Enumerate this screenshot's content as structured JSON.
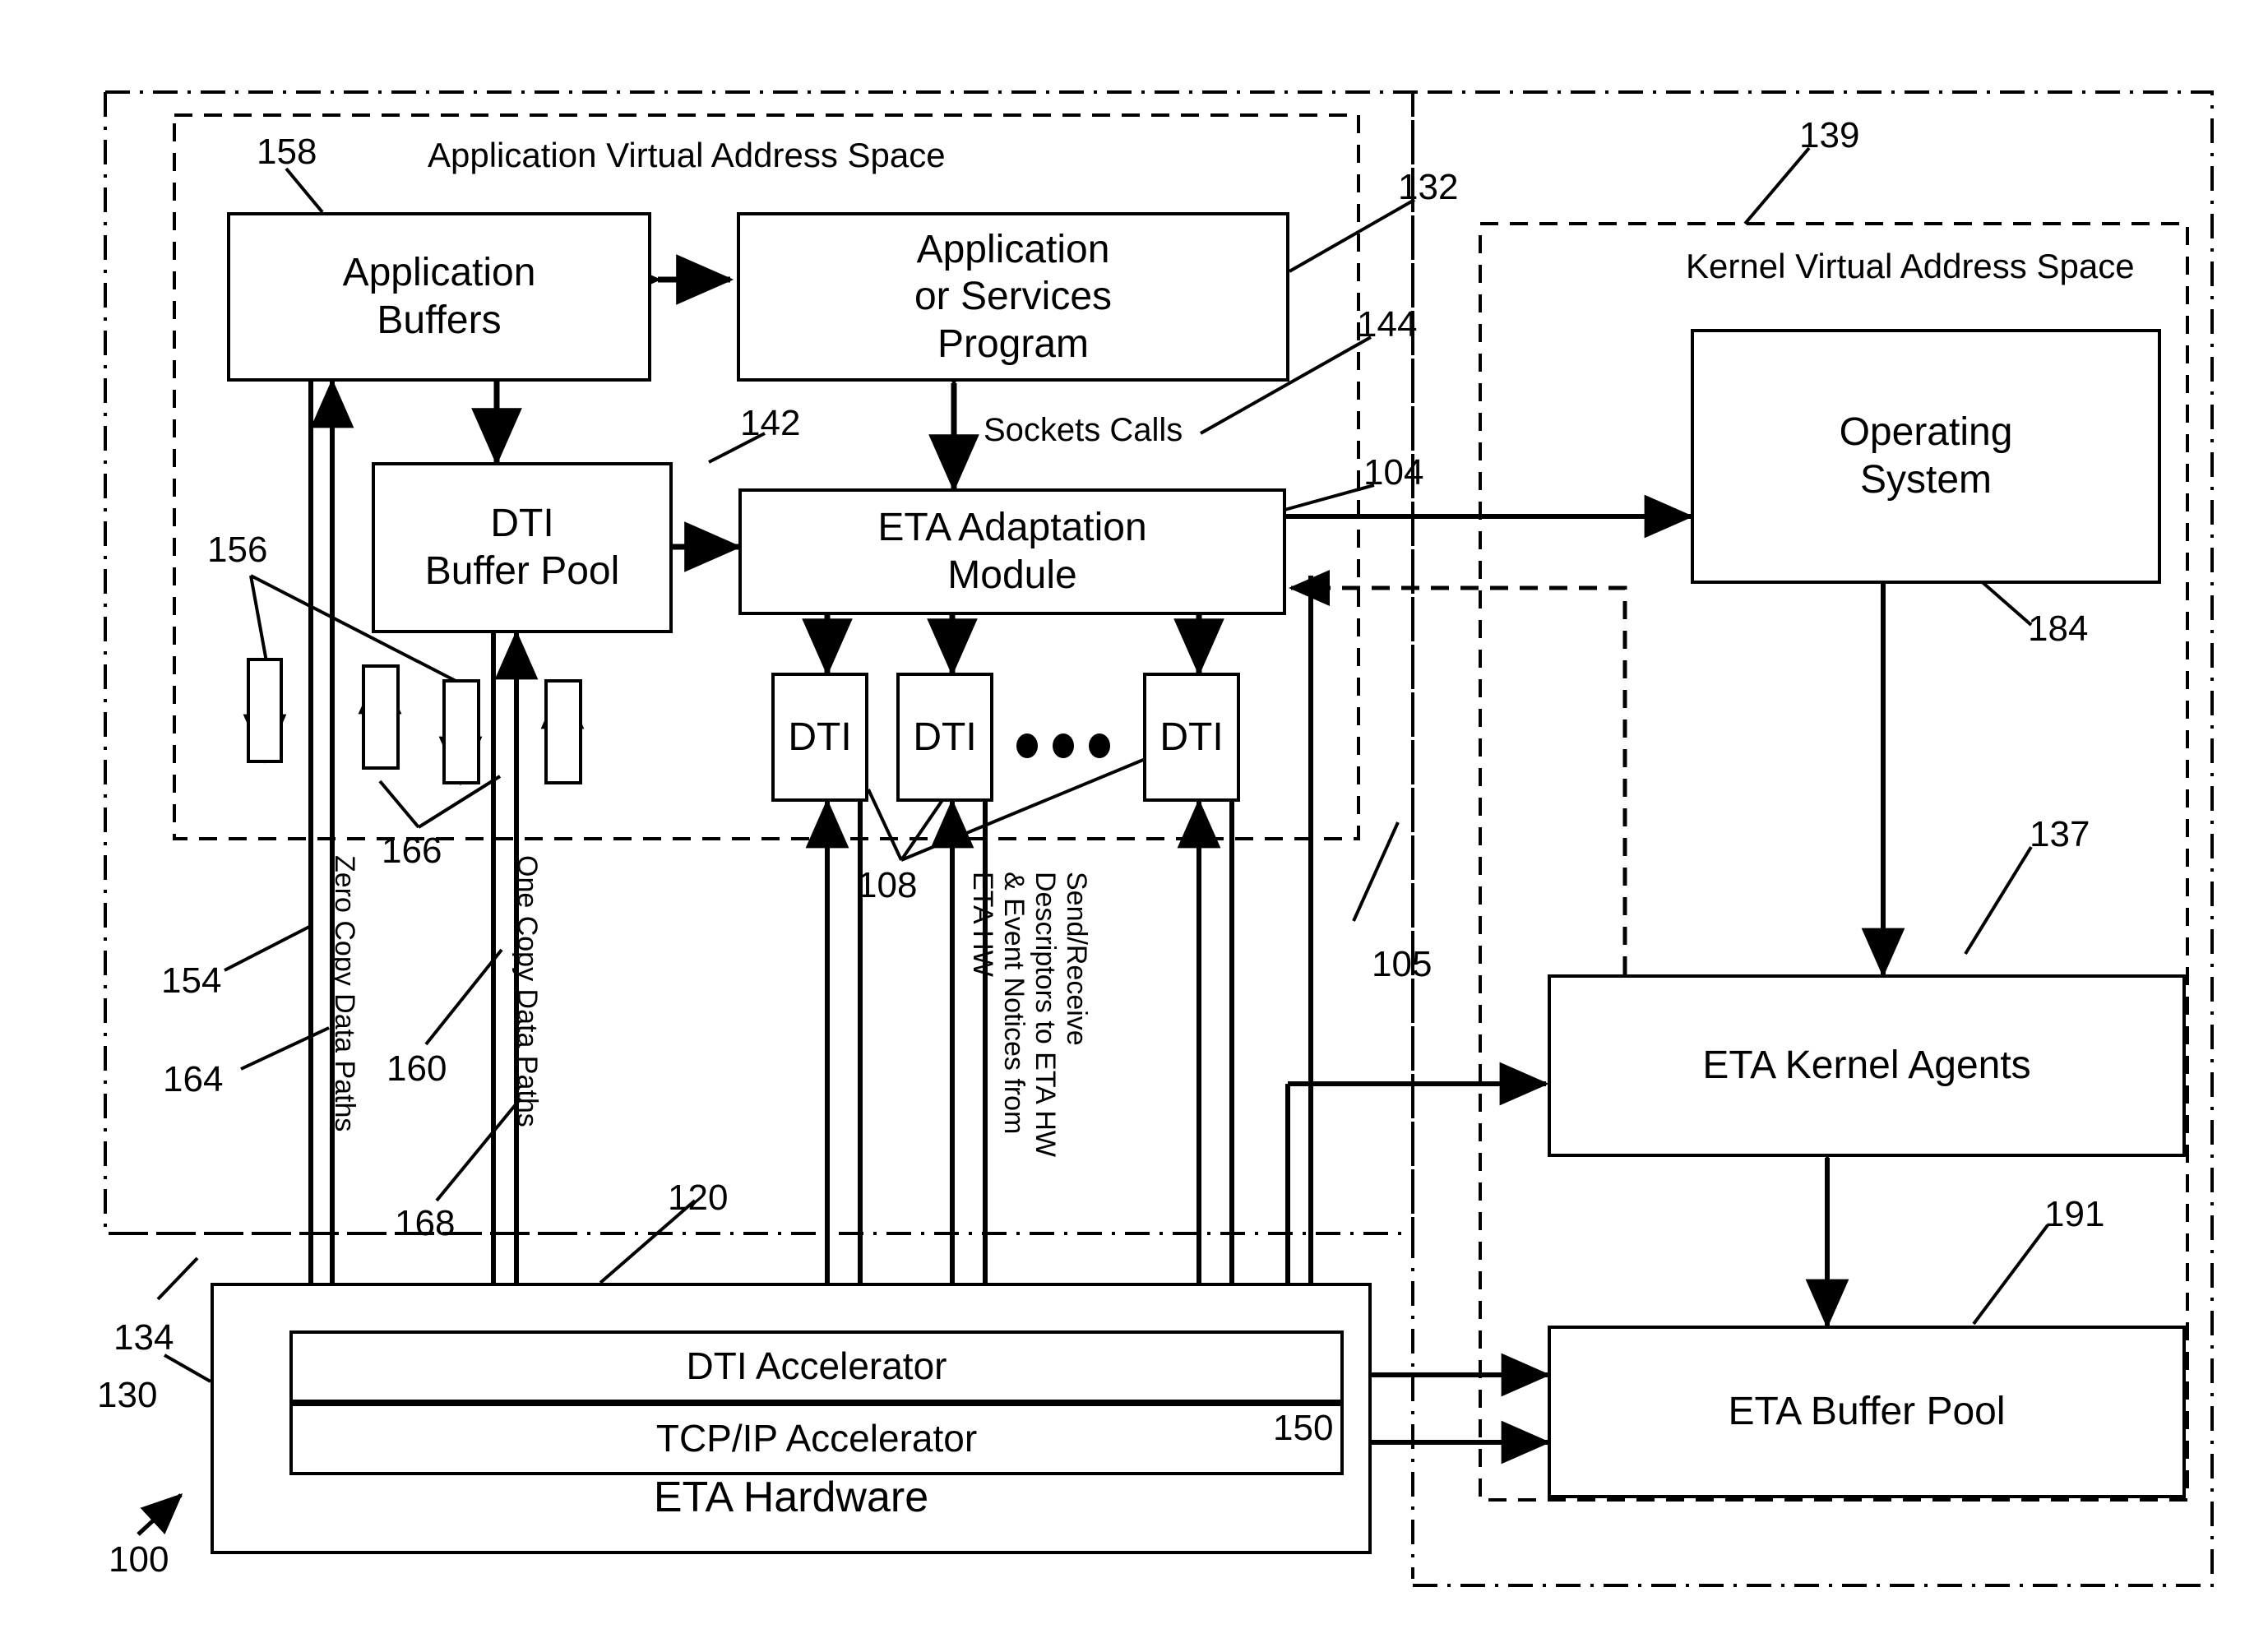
{
  "figure": {
    "regions": [
      {
        "id": "outer",
        "label": "",
        "style": "dash-dot"
      },
      {
        "id": "app-space",
        "label": "Application Virtual Address Space",
        "style": "dashed"
      },
      {
        "id": "kernel-space",
        "label": "Kernel Virtual Address Space",
        "style": "dashed"
      }
    ],
    "boxes": {
      "application_buffers": "Application\nBuffers",
      "application_buffers_line1": "Application",
      "application_buffers_line2": "Buffers",
      "app_or_services_line1": "Application",
      "app_or_services_line2": "or Services",
      "app_or_services_line3": "Program",
      "dti_buffer_pool_line1": "DTI",
      "dti_buffer_pool_line2": "Buffer Pool",
      "eta_adaptation_line1": "ETA Adaptation",
      "eta_adaptation_line2": "Module",
      "operating_system_line1": "Operating",
      "operating_system_line2": "System",
      "eta_kernel_agents": "ETA Kernel Agents",
      "eta_buffer_pool": "ETA Buffer Pool",
      "dti_1": "DTI",
      "dti_2": "DTI",
      "dti_n": "DTI",
      "dti_accelerator": "DTI Accelerator",
      "tcpip_accelerator": "TCP/IP Accelerator",
      "eta_hardware": "ETA Hardware"
    },
    "annotations": {
      "sockets_calls": "Sockets Calls",
      "zero_copy": "Zero Copy Data Paths",
      "one_copy": "One Copy Data Paths",
      "send_receive_line1": "Send/Receive",
      "send_receive_line2": "Descriptors to ETA HW",
      "send_receive_line3": "& Event Notices from",
      "send_receive_line4": "ETA HW"
    },
    "reference_numerals": {
      "n100": "100",
      "n104": "104",
      "n105": "105",
      "n108": "108",
      "n120": "120",
      "n130": "130",
      "n132": "132",
      "n134": "134",
      "n137": "137",
      "n139": "139",
      "n142": "142",
      "n144": "144",
      "n150": "150",
      "n154": "154",
      "n156": "156",
      "n158": "158",
      "n160": "160",
      "n164": "164",
      "n166": "166",
      "n168": "168",
      "n184": "184",
      "n191": "191"
    },
    "colors": {
      "ink": "#000000",
      "paper": "#ffffff"
    }
  }
}
